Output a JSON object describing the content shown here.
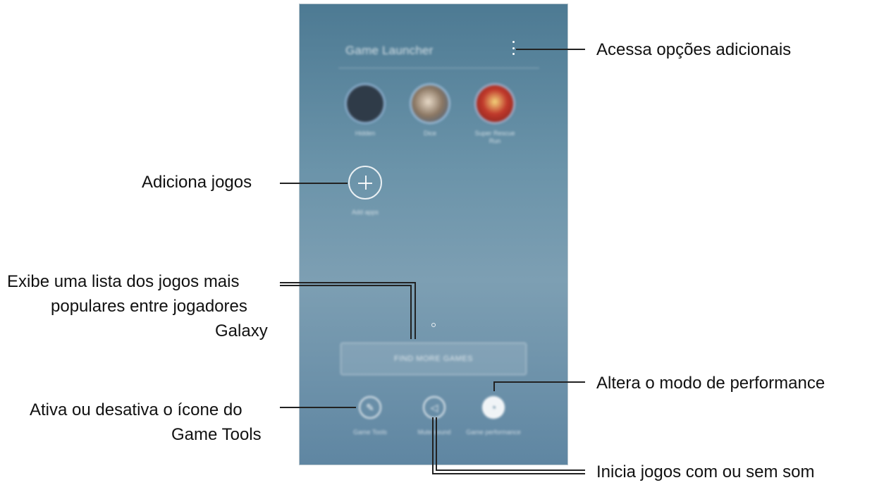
{
  "app": {
    "title": "Game Launcher",
    "games": [
      {
        "label": "Hidden",
        "color": "#2f3b48"
      },
      {
        "label": "Dice",
        "color": "#8a7662"
      },
      {
        "label": "Super Rescue Run",
        "color": "#c0392b"
      }
    ],
    "add_label": "Add apps",
    "more_games_label": "FIND MORE GAMES",
    "tools": [
      {
        "label": "Game Tools",
        "icon": "game-tools-icon"
      },
      {
        "label": "Mute sound",
        "icon": "mute-icon"
      },
      {
        "label": "Game performance",
        "icon": "performance-icon"
      }
    ]
  },
  "callouts": {
    "options": "Acessa opções adicionais",
    "add_games": "Adiciona jogos",
    "popular_line1": "Exibe uma lista dos jogos mais",
    "popular_line2": "populares entre jogadores",
    "popular_line3": "Galaxy",
    "performance": "Altera o modo de performance",
    "tools_line1": "Ativa ou desativa o ícone do",
    "tools_line2": "Game Tools",
    "sound": "Inicia jogos com ou sem som"
  }
}
